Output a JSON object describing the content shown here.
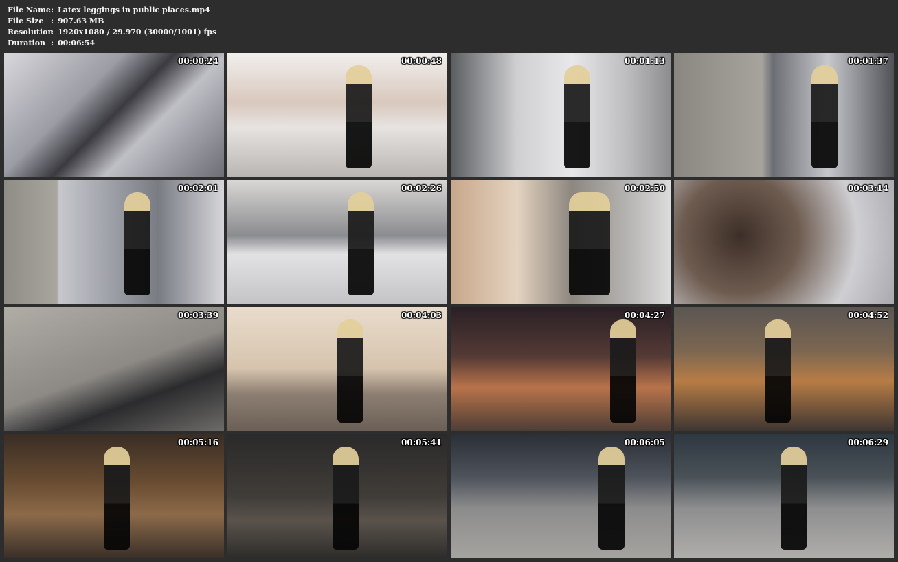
{
  "info": {
    "rows": [
      {
        "key": "File Name",
        "sep": ":",
        "value": "Latex leggings in public places.mp4"
      },
      {
        "key": "File Size",
        "sep": ":",
        "value": "907.63 MB"
      },
      {
        "key": "Resolution",
        "sep": ":",
        "value": "1920x1080 / 29.970 (30000/1001) fps"
      },
      {
        "key": "Duration",
        "sep": ":",
        "value": "00:06:54"
      }
    ]
  },
  "thumbnails": [
    {
      "timestamp": "00:00:24"
    },
    {
      "timestamp": "00:00:48"
    },
    {
      "timestamp": "00:01:13"
    },
    {
      "timestamp": "00:01:37"
    },
    {
      "timestamp": "00:02:01"
    },
    {
      "timestamp": "00:02:26"
    },
    {
      "timestamp": "00:02:50"
    },
    {
      "timestamp": "00:03:14"
    },
    {
      "timestamp": "00:03:39"
    },
    {
      "timestamp": "00:04:03"
    },
    {
      "timestamp": "00:04:27"
    },
    {
      "timestamp": "00:04:52"
    },
    {
      "timestamp": "00:05:16"
    },
    {
      "timestamp": "00:05:41"
    },
    {
      "timestamp": "00:06:05"
    },
    {
      "timestamp": "00:06:29"
    }
  ]
}
